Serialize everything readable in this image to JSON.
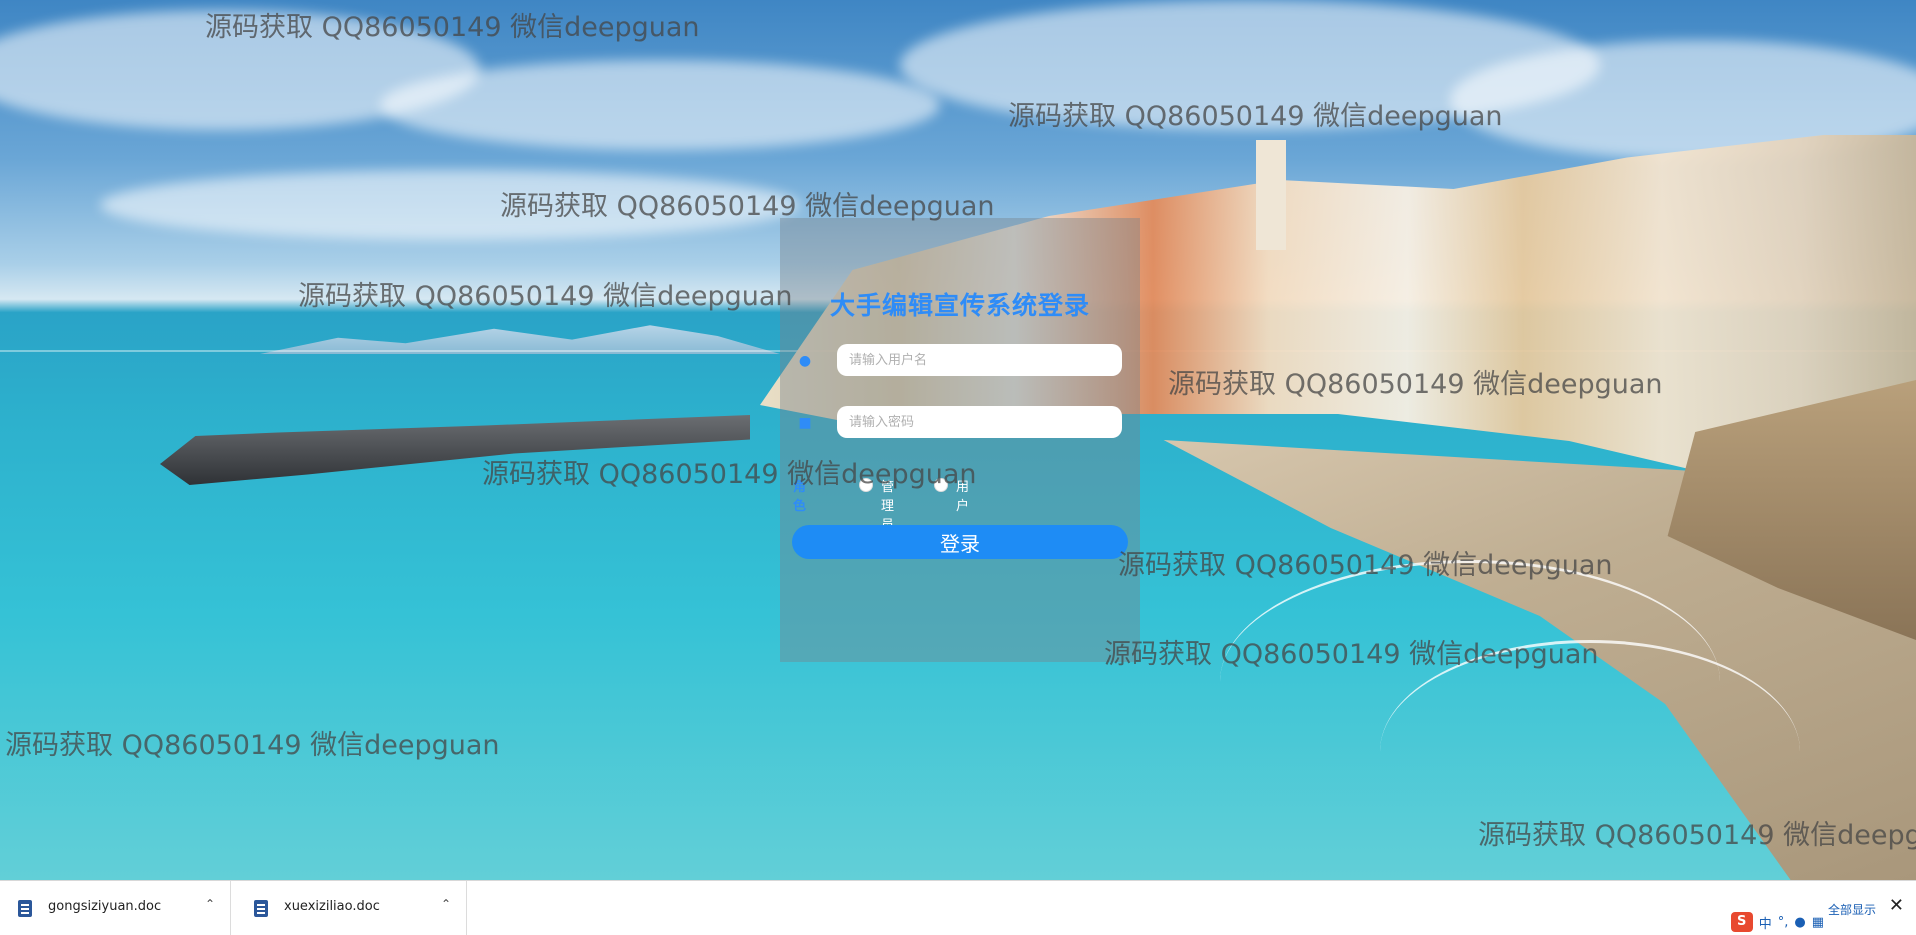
{
  "watermarks": [
    "源码获取 QQ86050149 微信deepguan",
    "源码获取 QQ86050149 微信deepguan",
    "源码获取 QQ86050149 微信deepguan",
    "源码获取 QQ86050149 微信deepguan",
    "源码获取 QQ86050149 微信deepguan",
    "源码获取 QQ86050149 微信deepguan",
    "源码获取 QQ86050149 微信deepguan",
    "源码获取 QQ86050149 微信deepguan",
    "源码获取 QQ86050149 微信deepguan",
    "源码获取 QQ86050149 微信deepguan"
  ],
  "login": {
    "title": "大手编辑宣传系统登录",
    "username_placeholder": "请输入用户名",
    "password_placeholder": "请输入密码",
    "role_label": "角色",
    "roles": [
      "管理员",
      "用户"
    ],
    "submit_label": "登录",
    "accent_color": "#1e8cf5"
  },
  "taskbar": {
    "downloads": [
      {
        "name": "gongsiziyuan.doc",
        "icon": "word-doc-icon"
      },
      {
        "name": "xuexiziliao.doc",
        "icon": "word-doc-icon"
      }
    ],
    "show_all_label": "全部显示",
    "ime_label": "中",
    "ime_logo": "S"
  }
}
